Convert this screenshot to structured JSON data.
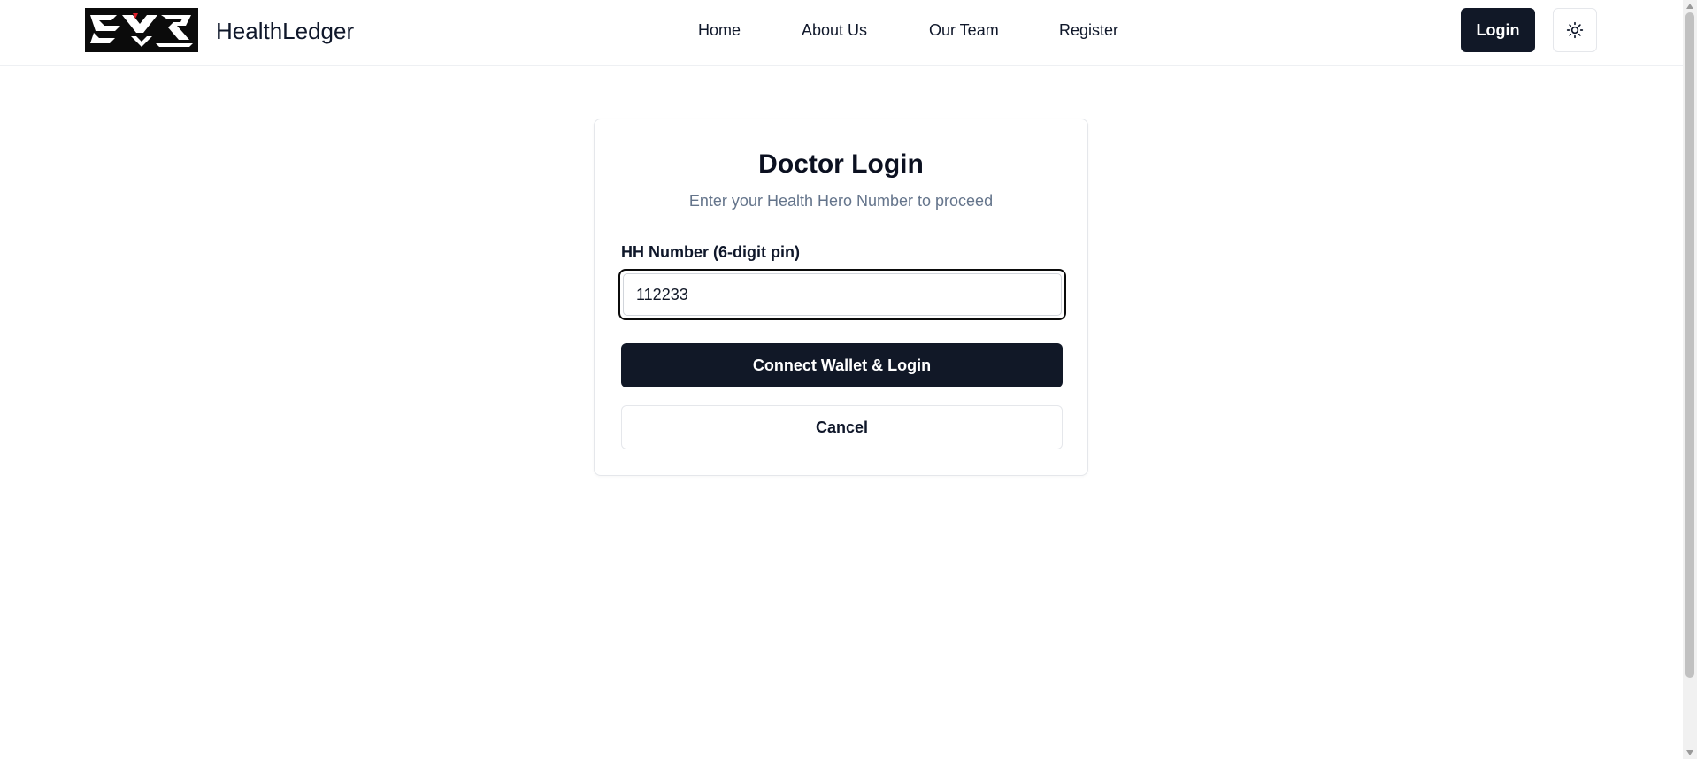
{
  "header": {
    "logo_icon": "ehr-logo",
    "brand_name": "HealthLedger",
    "nav": [
      {
        "label": "Home"
      },
      {
        "label": "About Us"
      },
      {
        "label": "Our Team"
      },
      {
        "label": "Register"
      }
    ],
    "login_label": "Login",
    "theme_icon": "sun-icon"
  },
  "login_card": {
    "title": "Doctor Login",
    "subtitle": "Enter your Health Hero Number to proceed",
    "field_label": "HH Number (6-digit pin)",
    "field_value": "112233",
    "primary_button": "Connect Wallet & Login",
    "secondary_button": "Cancel"
  },
  "colors": {
    "primary": "#111827",
    "muted_text": "#64748b",
    "logo_accent": "#e0202a"
  }
}
